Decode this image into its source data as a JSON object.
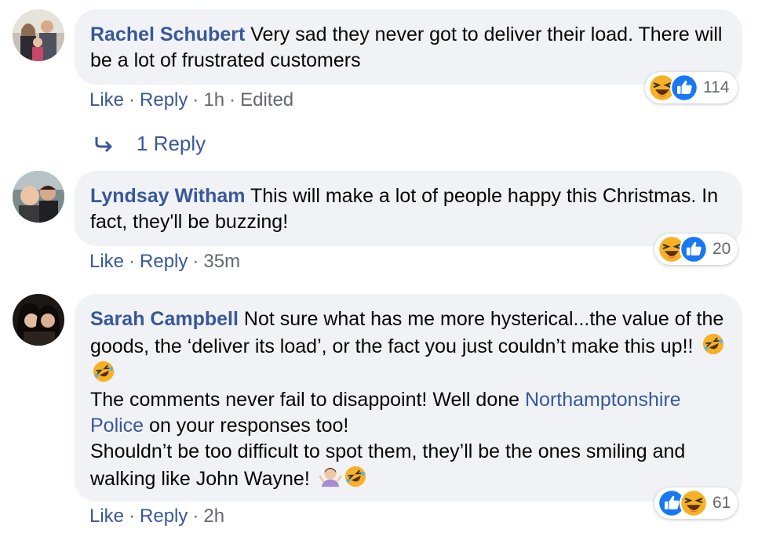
{
  "comments": [
    {
      "author": "Rachel Schubert",
      "text": "Very sad they never got to deliver their load. There will be a lot of frustrated customers",
      "actions": {
        "like": "Like",
        "reply": "Reply",
        "time": "1h",
        "edited": "Edited"
      },
      "reactions": {
        "icons": [
          "haha-icon",
          "like-icon"
        ],
        "count": "114"
      },
      "replies_label": "1 Reply"
    },
    {
      "author": "Lyndsay Witham",
      "text": "This will make a lot of people happy this Christmas. In fact, they'll be buzzing!",
      "actions": {
        "like": "Like",
        "reply": "Reply",
        "time": "35m"
      },
      "reactions": {
        "icons": [
          "haha-icon",
          "like-icon"
        ],
        "count": "20"
      }
    },
    {
      "author": "Sarah Campbell",
      "text_part1": "Not sure what has me more hysterical...the value of the goods, the ‘deliver its load’, or the fact you just couldn’t make this up!!",
      "text_part2": "The comments never fail to disappoint! Well done",
      "mention": "Northamptonshire Police",
      "text_part3": "on your responses too!",
      "text_part4": "Shouldn’t be too difficult to spot them, they’ll be the ones smiling and walking like John Wayne!",
      "actions": {
        "like": "Like",
        "reply": "Reply",
        "time": "2h"
      },
      "reactions": {
        "icons": [
          "like-icon",
          "haha-icon"
        ],
        "count": "61"
      }
    }
  ],
  "colors": {
    "link": "#385898",
    "bubble": "#f0f2f5",
    "meta": "#65676b",
    "like_blue": "#1877f2",
    "haha_yellow": "#f7b125"
  }
}
